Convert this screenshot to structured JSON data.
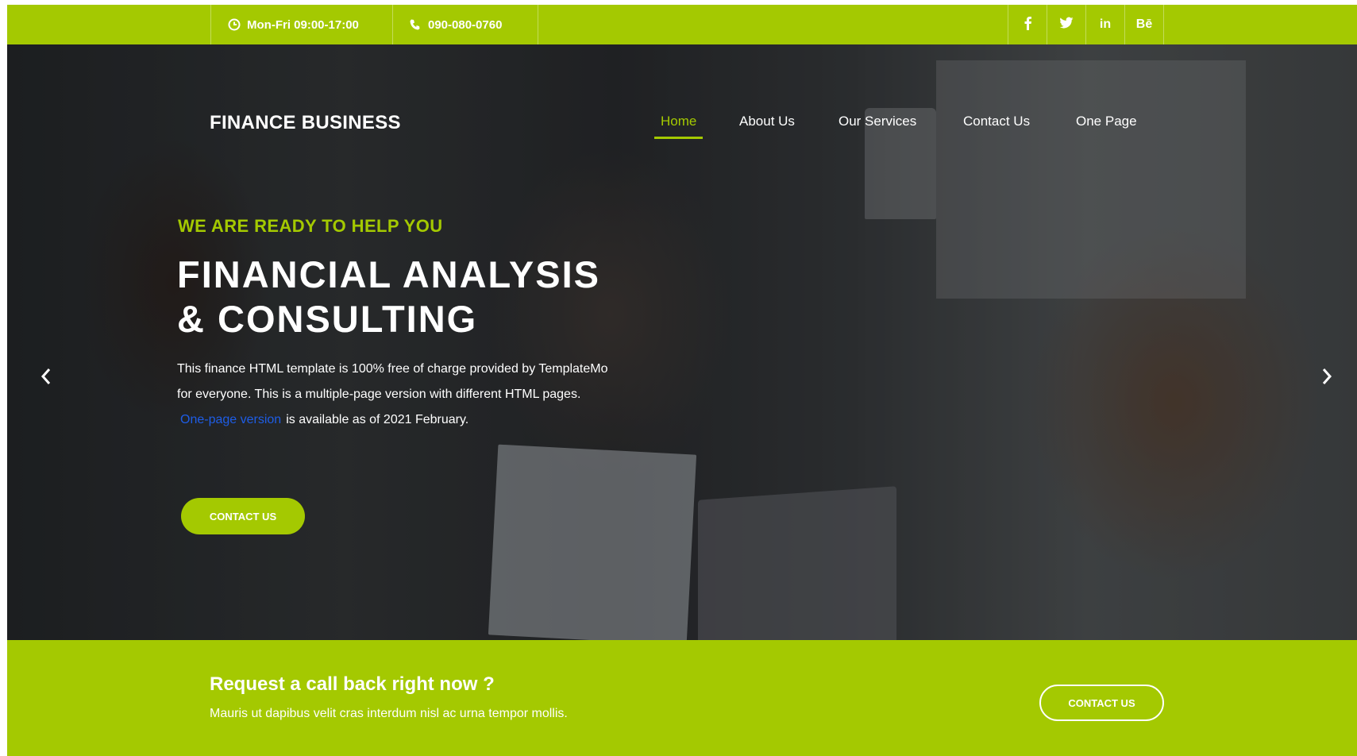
{
  "topbar": {
    "hours": "Mon-Fri 09:00-17:00",
    "phone": "090-080-0760",
    "social": [
      {
        "label": "f",
        "icon": "facebook-icon"
      },
      {
        "label": "🐦",
        "icon": "twitter-icon"
      },
      {
        "label": "in",
        "icon": "linkedin-icon"
      },
      {
        "label": "Bē",
        "icon": "behance-icon"
      }
    ]
  },
  "header": {
    "logo": "FINANCE BUSINESS",
    "nav": [
      "Home",
      "About Us",
      "Our Services",
      "Contact Us",
      "One Page"
    ],
    "active_nav": "Home"
  },
  "hero": {
    "tagline": "WE ARE READY TO HELP YOU",
    "title_line1": "FINANCIAL ANALYSIS",
    "title_line2": "& CONSULTING",
    "desc_line1": "This finance HTML template is 100% free of charge provided by TemplateMo",
    "desc_line2": "for everyone. This is a multiple-page version with different HTML pages.",
    "desc_link": "One-page version",
    "desc_line3": "is available as of 2021 February.",
    "button": "CONTACT US"
  },
  "callback": {
    "title": "Request a call back right now ?",
    "text": "Mauris ut dapibus velit cras interdum nisl ac urna tempor mollis.",
    "button": "CONTACT US"
  },
  "colors": {
    "accent": "#a4c901",
    "link": "#1e5de6"
  }
}
